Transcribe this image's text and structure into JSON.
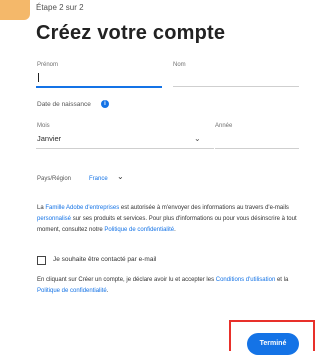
{
  "step": "Étape 2 sur 2",
  "title": "Créez votre compte",
  "first_name": {
    "label": "Prénom",
    "value": ""
  },
  "last_name": {
    "label": "Nom",
    "value": ""
  },
  "birth": {
    "label": "Date de naissance",
    "month_label": "Mois",
    "month_value": "Janvier",
    "year_label": "Année",
    "year_value": ""
  },
  "country": {
    "label": "Pays/Région",
    "value": "France"
  },
  "consent": {
    "p1_a": "La ",
    "p1_link1": "Famille Adobe d'entreprises",
    "p1_b": " est autorisée à m'envoyer des informations au travers d'e-mails ",
    "p1_link2": "personnalisé",
    "p1_c": " sur ses produits et services. Pour plus d'informations ou pour vous désinscrire à tout moment, consultez notre ",
    "p1_link3": "Politique de confidentialité",
    "p1_d": "."
  },
  "checkbox_label": "Je souhaite être contacté par e-mail",
  "terms": {
    "a": "En cliquant sur Créer un compte, je déclare avoir lu et accepter les ",
    "link1": "Conditions d'utilisation",
    "b": " et la ",
    "link2": "Politique de confidentialité",
    "c": "."
  },
  "submit_label": "Terminé",
  "colors": {
    "accent": "#1473e6",
    "highlight": "#e8302a",
    "corner": "#f4b86a"
  },
  "icons": {
    "info": "info-icon",
    "chevron": "chevron-down-icon"
  }
}
